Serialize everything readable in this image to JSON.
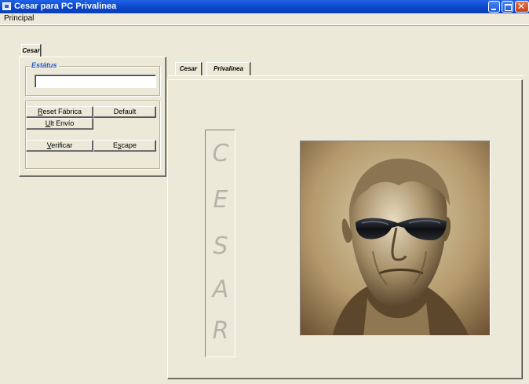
{
  "window": {
    "title": "Cesar para PC Privalinea",
    "icon": "app-window-icon",
    "controls": [
      "minimize-icon",
      "maximize-icon",
      "close-icon"
    ]
  },
  "menu": {
    "items": [
      {
        "label": "Principal"
      }
    ]
  },
  "left_panel": {
    "tab_label": "Cesar",
    "status_frame": {
      "label": "Estátus",
      "value": ""
    },
    "buttons": {
      "reset": {
        "mnemonic": "R",
        "rest": "eset Fábrica"
      },
      "default": {
        "label": "Default"
      },
      "ult_envio": {
        "mnemonic": "U",
        "rest": "lt Envío"
      },
      "verificar": {
        "mnemonic": "V",
        "rest": "erificar"
      },
      "escape": {
        "before": "E",
        "mnemonic": "s",
        "rest": "cape"
      }
    }
  },
  "right_panel": {
    "tabs": [
      {
        "label": "Cesar"
      },
      {
        "label": "Privalinea"
      }
    ],
    "vertical_letters": [
      "C",
      "E",
      "S",
      "A",
      "R"
    ],
    "image": "bust-with-sunglasses-portrait"
  },
  "colors": {
    "titlebar": "#0a45c8",
    "face": "#ece9d8",
    "status_label": "#2958ce",
    "letters": "#b4b4aa"
  }
}
